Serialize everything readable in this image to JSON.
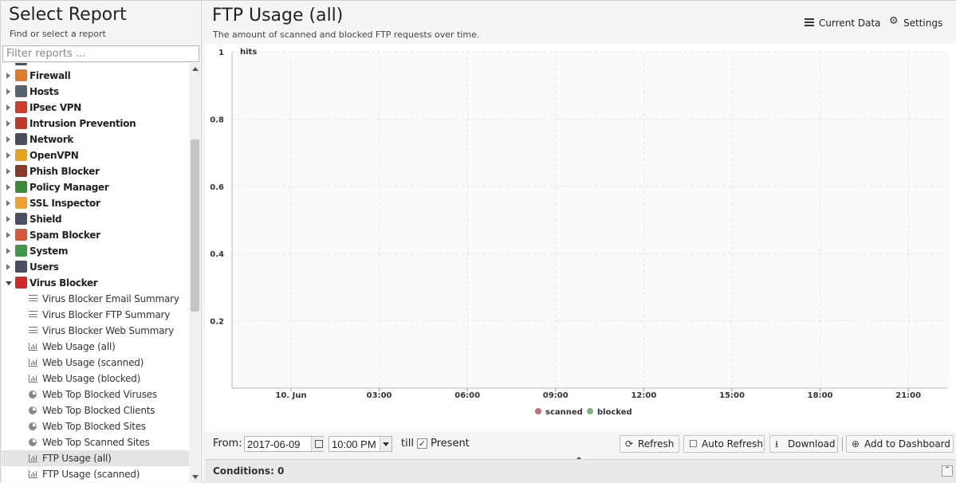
{
  "left_panel": {
    "title": "Select Report",
    "subtitle": "Find or select a report",
    "filter_placeholder": "Filter reports ...",
    "groups": [
      {
        "label": "Firewall",
        "icon": "firewall-icon",
        "color": "#e07b2c",
        "expanded": false
      },
      {
        "label": "Hosts",
        "icon": "hosts-icon",
        "color": "#5a6270",
        "expanded": false
      },
      {
        "label": "IPsec VPN",
        "icon": "ipsec-vpn-icon",
        "color": "#d23b2a",
        "expanded": false
      },
      {
        "label": "Intrusion Prevention",
        "icon": "intrusion-prevention-icon",
        "color": "#c0392b",
        "expanded": false
      },
      {
        "label": "Network",
        "icon": "network-icon",
        "color": "#4a4f5a",
        "expanded": false
      },
      {
        "label": "OpenVPN",
        "icon": "openvpn-icon",
        "color": "#e6a220",
        "expanded": false
      },
      {
        "label": "Phish Blocker",
        "icon": "phish-blocker-icon",
        "color": "#8a3b2a",
        "expanded": false
      },
      {
        "label": "Policy Manager",
        "icon": "policy-manager-icon",
        "color": "#3a8a3a",
        "expanded": false
      },
      {
        "label": "SSL Inspector",
        "icon": "ssl-inspector-icon",
        "color": "#f0a030",
        "expanded": false
      },
      {
        "label": "Shield",
        "icon": "shield-icon",
        "color": "#4a5060",
        "expanded": false
      },
      {
        "label": "Spam Blocker",
        "icon": "spam-blocker-icon",
        "color": "#d65a3a",
        "expanded": false
      },
      {
        "label": "System",
        "icon": "system-icon",
        "color": "#3e9a4a",
        "expanded": false
      },
      {
        "label": "Users",
        "icon": "users-icon",
        "color": "#4a5060",
        "expanded": false
      },
      {
        "label": "Virus Blocker",
        "icon": "virus-blocker-icon",
        "color": "#d02a2a",
        "expanded": true
      }
    ],
    "children": [
      {
        "label": "Virus Blocker Email Summary",
        "icon": "text-report-icon",
        "kind": "lines",
        "selected": false
      },
      {
        "label": "Virus Blocker FTP Summary",
        "icon": "text-report-icon",
        "kind": "lines",
        "selected": false
      },
      {
        "label": "Virus Blocker Web Summary",
        "icon": "text-report-icon",
        "kind": "lines",
        "selected": false
      },
      {
        "label": "Web Usage (all)",
        "icon": "bar-chart-icon",
        "kind": "bar",
        "selected": false
      },
      {
        "label": "Web Usage (scanned)",
        "icon": "bar-chart-icon",
        "kind": "bar",
        "selected": false
      },
      {
        "label": "Web Usage (blocked)",
        "icon": "bar-chart-icon",
        "kind": "bar",
        "selected": false
      },
      {
        "label": "Web Top Blocked Viruses",
        "icon": "pie-chart-icon",
        "kind": "pie",
        "selected": false
      },
      {
        "label": "Web Top Blocked Clients",
        "icon": "pie-chart-icon",
        "kind": "pie",
        "selected": false
      },
      {
        "label": "Web Top Blocked Sites",
        "icon": "pie-chart-icon",
        "kind": "pie",
        "selected": false
      },
      {
        "label": "Web Top Scanned Sites",
        "icon": "pie-chart-icon",
        "kind": "pie",
        "selected": false
      },
      {
        "label": "FTP Usage (all)",
        "icon": "bar-chart-icon",
        "kind": "bar",
        "selected": true
      },
      {
        "label": "FTP Usage (scanned)",
        "icon": "bar-chart-icon",
        "kind": "bar",
        "selected": false
      }
    ]
  },
  "report": {
    "title": "FTP Usage (all)",
    "description": "The amount of scanned and blocked FTP requests over time.",
    "current_data_label": "Current Data",
    "settings_label": "Settings"
  },
  "chart_data": {
    "type": "bar",
    "ylabel": "hits",
    "y_ticks": [
      "0.2",
      "0.4",
      "0.6",
      "0.8",
      "1"
    ],
    "ylim": [
      0,
      1
    ],
    "x_ticks": [
      "10. Jun",
      "03:00",
      "06:00",
      "09:00",
      "12:00",
      "15:00",
      "18:00",
      "21:00"
    ],
    "series": [
      {
        "name": "scanned",
        "color": "#c2727a",
        "values": []
      },
      {
        "name": "blocked",
        "color": "#7fb07f",
        "values": []
      }
    ],
    "grid": true,
    "legend": "bottom-center"
  },
  "toolbar": {
    "from_label": "From:",
    "date_value": "2017-06-09",
    "time_value": "10:00 PM",
    "till_label": "till",
    "present_label": "Present",
    "present_checked": "✓",
    "refresh_label": "Refresh",
    "auto_refresh_label": "Auto Refresh",
    "download_label": "Download",
    "add_dashboard_label": "Add to Dashboard"
  },
  "conditions": {
    "label": "Conditions: 0",
    "toggle": "⌃"
  }
}
